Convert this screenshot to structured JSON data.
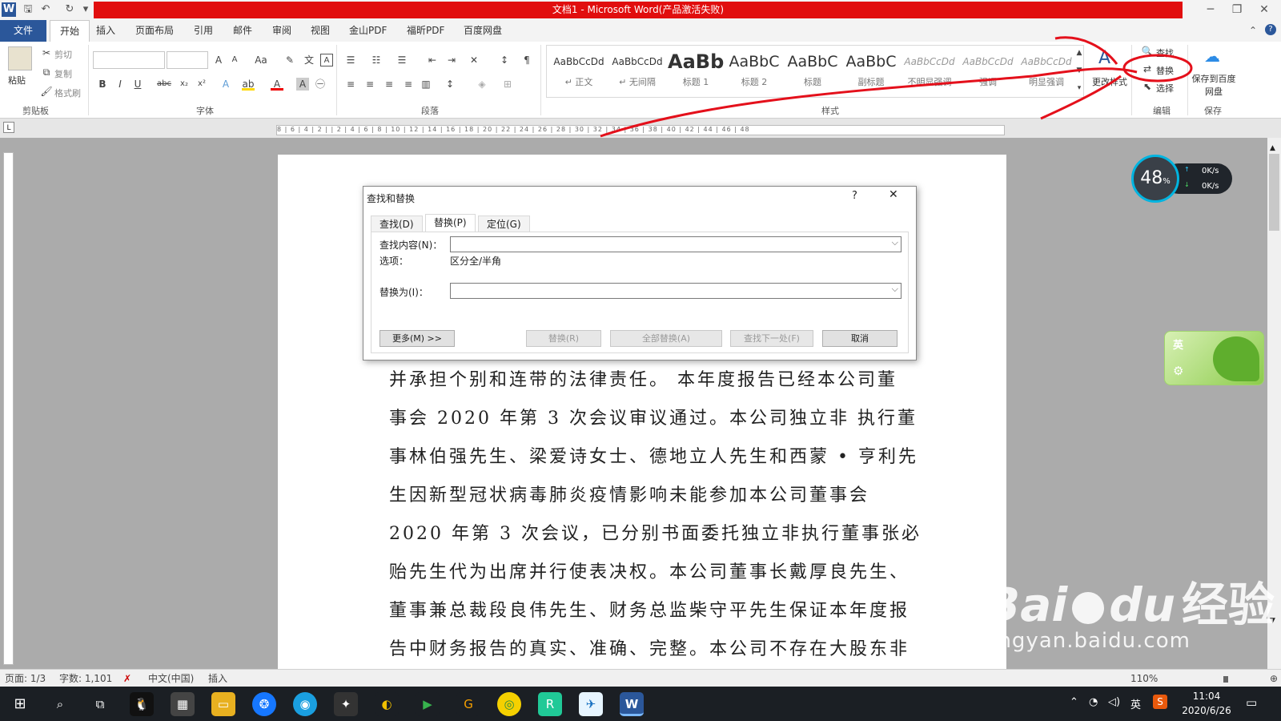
{
  "window": {
    "title": "文档1 - Microsoft Word(产品激活失败)"
  },
  "tabs": [
    "文件",
    "开始",
    "插入",
    "页面布局",
    "引用",
    "邮件",
    "审阅",
    "视图",
    "金山PDF",
    "福昕PDF",
    "百度网盘"
  ],
  "ribbon": {
    "clipboard": {
      "paste": "粘贴",
      "cut": "剪切",
      "copy": "复制",
      "format_painter": "格式刷",
      "group": "剪贴板"
    },
    "font": {
      "group": "字体"
    },
    "paragraph": {
      "group": "段落"
    },
    "styles": {
      "group": "样式",
      "items": [
        {
          "sample": "AaBbCcDd",
          "name": "↵ 正文"
        },
        {
          "sample": "AaBbCcDd",
          "name": "↵ 无间隔"
        },
        {
          "sample": "AaBb",
          "name": "标题 1"
        },
        {
          "sample": "AaBbC",
          "name": "标题 2"
        },
        {
          "sample": "AaBbC",
          "name": "标题"
        },
        {
          "sample": "AaBbC",
          "name": "副标题"
        },
        {
          "sample": "AaBbCcDd",
          "name": "不明显强调"
        },
        {
          "sample": "AaBbCcDd",
          "name": "强调"
        },
        {
          "sample": "AaBbCcDd",
          "name": "明显强调"
        }
      ],
      "change_styles": "更改样式"
    },
    "editing": {
      "find": "查找",
      "replace": "替换",
      "select": "选择",
      "group": "编辑"
    },
    "save": {
      "label": "保存到百度网盘",
      "group": "保存"
    }
  },
  "ruler": {
    "labels": "8 | 6 | 4 | 2 | | 2 | 4 | 6 | 8 | 10 | 12 | 14 | 16 | 18 | 20 | 22 | 24 | 26 | 28 | 30 | 32 | 34 | 36 | 38 | 40 | 42 | 44 | 46 | 48"
  },
  "document": {
    "lines": [
      "并承担个别和连带的法律责任。  本年度报告已经本公司董",
      "事会 2020 年第 3 次会议审议通过。本公司独立非 执行董",
      "事林伯强先生、梁爱诗女士、德地立人先生和西蒙 • 亨利先",
      "生因新型冠状病毒肺炎疫情影响未能参加本公司董事会",
      "2020 年第 3 次会议，已分别书面委托独立非执行董事张必",
      "贻先生代为出席并行使表决权。本公司董事长戴厚良先生、",
      "董事兼总裁段良伟先生、财务总监柴守平先生保证本年度报",
      "告中财务报告的真实、准确、完整。本公司不存在大股东非"
    ]
  },
  "dialog": {
    "title": "查找和替换",
    "help": "?",
    "close": "✕",
    "tabs": [
      "查找(D)",
      "替换(P)",
      "定位(G)"
    ],
    "find_label": "查找内容(N)：",
    "find_value": "",
    "options_label": "选项：",
    "options_value": "区分全/半角",
    "replace_label": "替换为(I)：",
    "replace_value": "",
    "buttons": {
      "more": "更多(M) >>",
      "replace": "替换(R)",
      "replace_all": "全部替换(A)",
      "find_next": "查找下一处(F)",
      "cancel": "取消"
    }
  },
  "statusbar": {
    "page": "页面: 1/3",
    "words": "字数: 1,101",
    "language": "中文(中国)",
    "mode": "插入",
    "zoom": "110%"
  },
  "net_widget": {
    "percent": "48",
    "percent_unit": "%",
    "up": "0K/s",
    "down": "0K/s"
  },
  "ime_widget": {
    "label": "英"
  },
  "taskbar": {
    "time": "11:04",
    "date": "2020/6/26",
    "ime": "英"
  },
  "watermark": {
    "brand": "Bai",
    "brand2": "du",
    "cn": "经验",
    "url": "jingyan.baidu.com"
  },
  "colors": {
    "title_red": "#e10e0e",
    "word_blue": "#2b579a",
    "annotation_red": "#e4101b"
  }
}
